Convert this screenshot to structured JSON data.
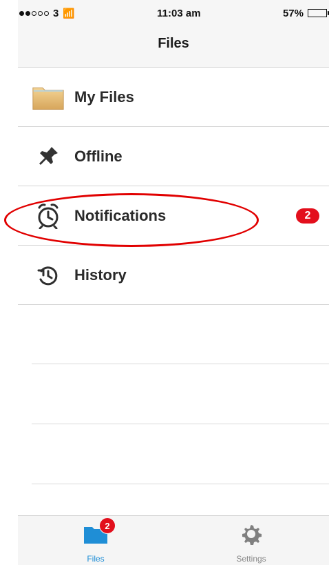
{
  "status_bar": {
    "carrier": "3",
    "time": "11:03 am",
    "battery": "57%",
    "battery_level": 0.57
  },
  "nav": {
    "title": "Files"
  },
  "menu": {
    "items": [
      {
        "label": "My Files",
        "icon": "folder-icon"
      },
      {
        "label": "Offline",
        "icon": "pin-icon"
      },
      {
        "label": "Notifications",
        "icon": "alarm-clock-icon",
        "badge": "2",
        "highlighted": true
      },
      {
        "label": "History",
        "icon": "history-icon"
      }
    ]
  },
  "tabs": {
    "files_label": "Files",
    "files_badge": "2",
    "settings_label": "Settings"
  },
  "colors": {
    "accent": "#1f8ed6",
    "badge_red": "#e30f1c",
    "highlight_red": "#e10000"
  }
}
